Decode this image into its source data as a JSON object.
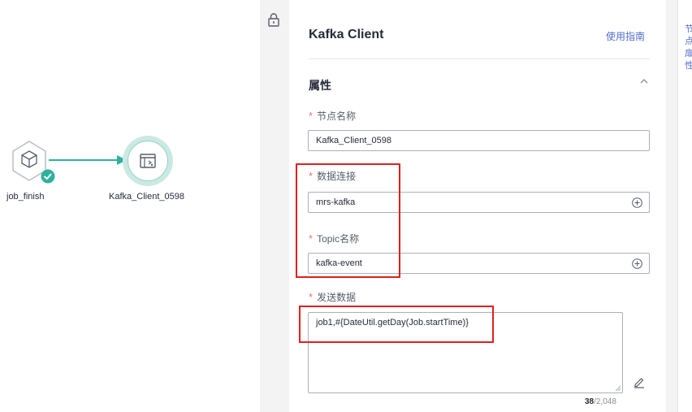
{
  "canvas": {
    "nodes": [
      {
        "label": "job_finish",
        "icon": "cube-icon",
        "status": "success"
      },
      {
        "label": "Kafka_Client_0598",
        "icon": "kafka-client-icon",
        "status": "selected"
      }
    ]
  },
  "panel": {
    "title": "Kafka Client",
    "guide_link": "使用指南",
    "section_title": "属性",
    "fields": {
      "node_name": {
        "label": "节点名称",
        "value": "Kafka_Client_0598"
      },
      "data_connection": {
        "label": "数据连接",
        "value": "mrs-kafka"
      },
      "topic_name": {
        "label": "Topic名称",
        "value": "kafka-event"
      },
      "send_data": {
        "label": "发送数据",
        "value": "job1,#{DateUtil.getDay(Job.startTime)}",
        "count": "38",
        "max": "/2,048"
      }
    },
    "required_mark": "*"
  },
  "right_edge_chars": [
    "节",
    "点",
    "扉",
    "性"
  ],
  "colors": {
    "accent": "#526ecc",
    "node_teal": "#2bb39b",
    "required": "#f66f6a",
    "highlight_box": "#e02020"
  }
}
